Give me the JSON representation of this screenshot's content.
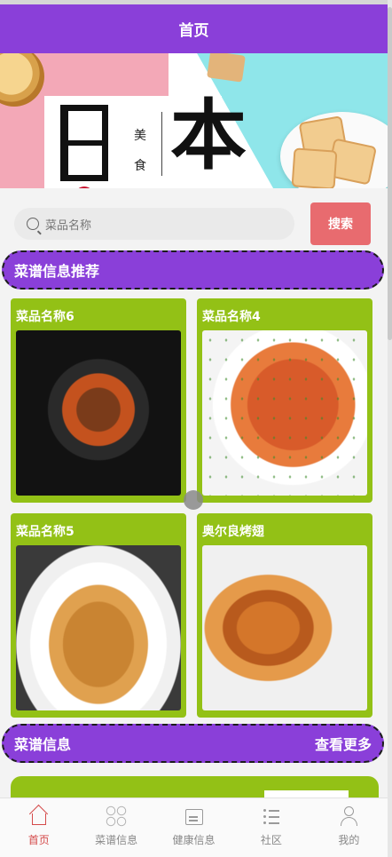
{
  "header": {
    "title": "首页"
  },
  "banner": {
    "big_char": "本",
    "vertical_text": "美食"
  },
  "search": {
    "placeholder": "菜品名称",
    "button_label": "搜索"
  },
  "section_recommend": {
    "title": "菜谱信息推荐"
  },
  "recommend_items": [
    {
      "name": "菜品名称6"
    },
    {
      "name": "菜品名称4"
    },
    {
      "name": "菜品名称5"
    },
    {
      "name": "奥尔良烤翅"
    }
  ],
  "section_recipes": {
    "title": "菜谱信息",
    "more_label": "查看更多"
  },
  "tabbar": {
    "items": [
      {
        "label": "首页",
        "icon": "home-icon",
        "active": true
      },
      {
        "label": "菜谱信息",
        "icon": "grid-icon",
        "active": false
      },
      {
        "label": "健康信息",
        "icon": "calendar-icon",
        "active": false
      },
      {
        "label": "社区",
        "icon": "list-icon",
        "active": false
      },
      {
        "label": "我的",
        "icon": "user-icon",
        "active": false
      }
    ]
  },
  "colors": {
    "primary": "#8a3fd9",
    "card": "#93c116",
    "search_button": "#e86b6f",
    "active_tab": "#d44a4a"
  }
}
